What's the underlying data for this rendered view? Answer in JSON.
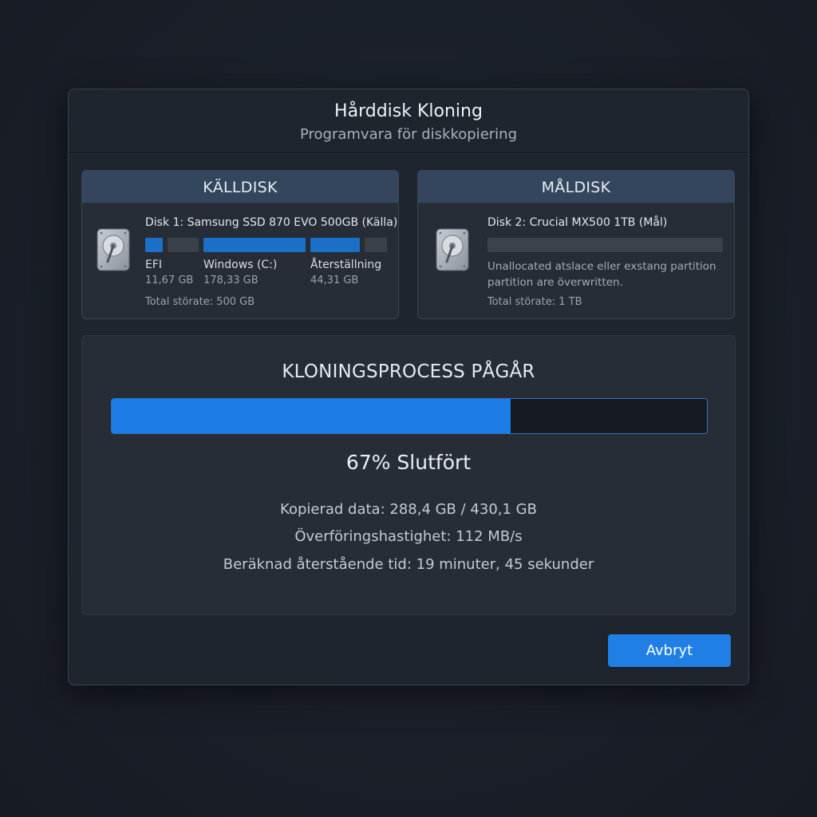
{
  "window": {
    "title": "Hårddisk Kloning",
    "subtitle": "Programvara för diskkopiering"
  },
  "source_disk": {
    "header": "KÄLLDISK",
    "name": "Disk 1: Samsung SSD 870 EVO 500GB (Källa)",
    "partitions": [
      {
        "label": "EFI",
        "size": "11,67 GB"
      },
      {
        "label": "Windows (C:)",
        "size": "178,33 GB"
      },
      {
        "label": "Återställning",
        "size": "44,31 GB"
      }
    ],
    "total": "Total störate: 500 GB",
    "icon": "hard-drive-icon"
  },
  "target_disk": {
    "header": "MÅLDISK",
    "name": "Disk 2: Crucial MX500 1TB (Mål)",
    "description_line1": "Unallocated atslace eller exstang partition",
    "description_line2": "partition are överwritten.",
    "total": "Total störate: 1 TB",
    "icon": "hard-drive-icon"
  },
  "process": {
    "title": "KLONINGSPROCESS PÅGÅR",
    "progress_percent": 67,
    "progress_text": "67% Slutfört",
    "copied": "Kopierad data: 288,4 GB / 430,1 GB",
    "speed": "Överföringshastighet: 112 MB/s",
    "remaining": "Beräknad återstående tid: 19 minuter, 45 sekunder"
  },
  "actions": {
    "cancel_label": "Avbryt"
  },
  "colors": {
    "accent": "#1f7fe5",
    "partition_used": "#1a6fc6",
    "partition_free": "#3a4149",
    "panel_header": "#34465e"
  }
}
